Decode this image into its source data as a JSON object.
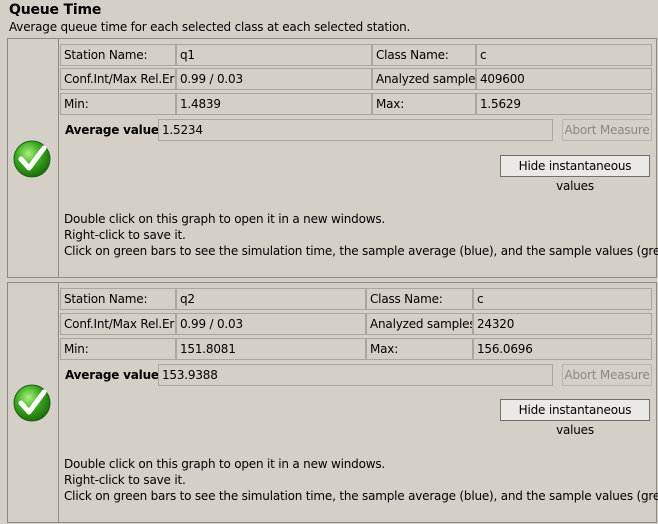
{
  "page": {
    "title": "Queue Time",
    "subtitle": "Average queue time for each selected class at each selected station."
  },
  "labels": {
    "station_name": "Station Name:",
    "class_name": "Class Name:",
    "conf_int": "Conf.Int/Max Rel.Err:",
    "analyzed_samples": "Analyzed samples:",
    "min": "Min:",
    "max": "Max:",
    "average_value": "Average value:",
    "abort_measure": "Abort Measure",
    "hide_instantaneous": "Hide instantaneous values",
    "info_line1": "Double click on this graph to open it in a new windows.",
    "info_line2": "Right-click to save it.",
    "info_line3": "Click on green bars to see the simulation time, the sample average (blue), and the sample values (green)."
  },
  "measures": [
    {
      "station_name": "q1",
      "class_name": "c",
      "conf_int": "0.99 / 0.03",
      "analyzed_samples": "409600",
      "min": "1.4839",
      "max": "1.5629",
      "average_value": "1.5234",
      "status_icon": "green-check-icon"
    },
    {
      "station_name": "q2",
      "class_name": "c",
      "conf_int": "0.99 / 0.03",
      "analyzed_samples": "24320",
      "min": "151.8081",
      "max": "156.0696",
      "average_value": "153.9388",
      "status_icon": "green-check-icon"
    }
  ],
  "colors": {
    "background": "#d4d0c8",
    "check_green": "#3aa51f",
    "disabled_text": "#8d8a83"
  }
}
